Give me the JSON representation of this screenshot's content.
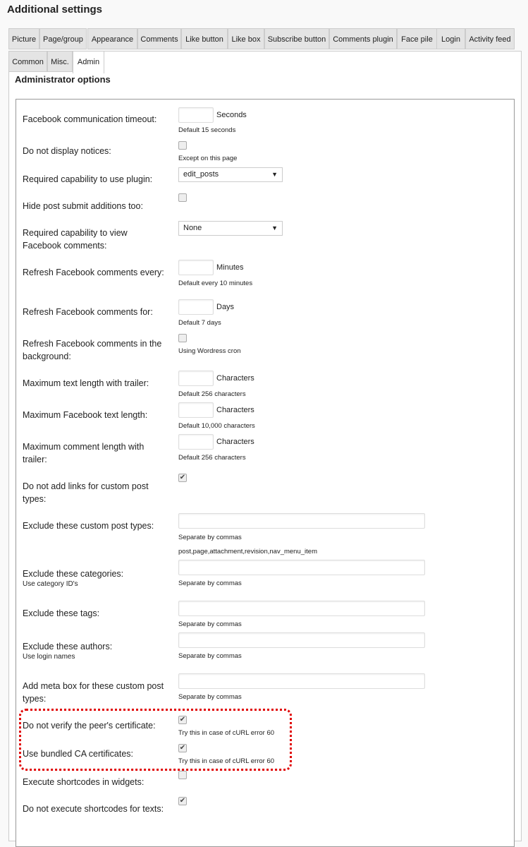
{
  "title": "Additional settings",
  "tabs": [
    "Picture",
    "Page/group",
    "Appearance",
    "Comments",
    "Like button",
    "Like box",
    "Subscribe button",
    "Comments plugin",
    "Face pile",
    "Login",
    "Activity feed",
    "Common",
    "Misc.",
    "Admin"
  ],
  "active_tab": "Admin",
  "section_title": "Administrator options",
  "highlight_color": "#e00000",
  "rows": [
    {
      "label": "Facebook communication timeout:",
      "type": "input",
      "value": "",
      "unit": "Seconds",
      "note": "Default 15 seconds"
    },
    {
      "label": "Do not display notices:",
      "type": "checkbox",
      "checked": false,
      "note": "Except on this page"
    },
    {
      "label": "Required capability to use plugin:",
      "type": "select",
      "value": "edit_posts"
    },
    {
      "label": "Hide post submit additions too:",
      "type": "checkbox",
      "checked": false
    },
    {
      "label": "Required capability to view Facebook comments:",
      "type": "select",
      "value": "None"
    },
    {
      "label": "Refresh Facebook comments every:",
      "type": "input",
      "value": "",
      "unit": "Minutes",
      "note": "Default every 10 minutes"
    },
    {
      "label": "Refresh Facebook comments for:",
      "type": "input",
      "value": "",
      "unit": "Days",
      "note": "Default 7 days"
    },
    {
      "label": "Refresh Facebook comments in the background:",
      "type": "checkbox",
      "checked": false,
      "note": "Using Wordress cron"
    },
    {
      "label": "Maximum text length with trailer:",
      "type": "input",
      "value": "",
      "unit": "Characters",
      "note": "Default 256 characters"
    },
    {
      "label": "Maximum Facebook text length:",
      "type": "input",
      "value": "",
      "unit": "Characters",
      "note": "Default 10,000 characters"
    },
    {
      "label": "Maximum comment length with trailer:",
      "type": "input",
      "value": "",
      "unit": "Characters",
      "note": "Default 256 characters"
    },
    {
      "label": "Do not add links for custom post types:",
      "type": "checkbox",
      "checked": true
    },
    {
      "label": "Exclude these custom post types:",
      "type": "wide",
      "value": "",
      "note": "Separate by commas",
      "note2": "post,page,attachment,revision,nav_menu_item"
    },
    {
      "label": "Exclude these categories:",
      "sublabel": "Use category ID's",
      "type": "wide",
      "value": "",
      "note": "Separate by commas"
    },
    {
      "label": "Exclude these tags:",
      "type": "wide",
      "value": "",
      "note": "Separate by commas"
    },
    {
      "label": "Exclude these authors:",
      "sublabel": "Use login names",
      "type": "wide",
      "value": "",
      "note": "Separate by commas"
    },
    {
      "label": "Add meta box for these custom post types:",
      "type": "wide",
      "value": "",
      "note": "Separate by commas"
    },
    {
      "label": "Do not verify the peer's certificate:",
      "type": "checkbox",
      "checked": true,
      "note": "Try this in case of cURL error 60"
    },
    {
      "label": "Use bundled CA certificates:",
      "type": "checkbox",
      "checked": true,
      "note": "Try this in case of cURL error 60"
    },
    {
      "label": "Execute shortcodes in widgets:",
      "type": "checkbox",
      "checked": false
    },
    {
      "label": "Do not execute shortcodes for texts:",
      "type": "checkbox",
      "checked": true
    }
  ]
}
